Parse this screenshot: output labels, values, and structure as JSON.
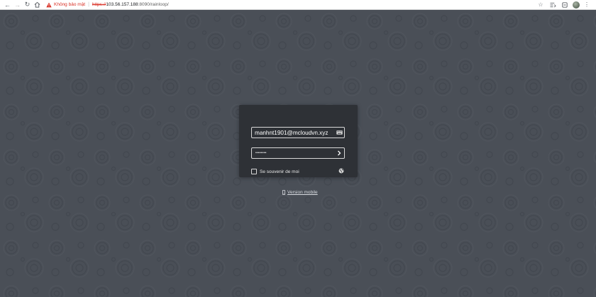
{
  "browser": {
    "security_label": "Không bảo mật",
    "url_scheme": "https://",
    "url_host": "103.56.157.188",
    "url_rest": ":8090/rainloop/",
    "warning_color": "#d93025"
  },
  "login": {
    "email_value": "manhnt1901@mcloudvn.xyz",
    "password_masked": "••••••••",
    "remember_label": "Se souvenir de moi",
    "submit_icon": "chevron-right-icon",
    "email_icon": "keyboard-icon",
    "language_icon": "globe-icon"
  },
  "footer": {
    "mobile_link_label": "Version mobile",
    "mobile_icon": "mobile-phone-icon"
  },
  "colors": {
    "background": "#4a4f57",
    "panel": "#2e3136",
    "field_border": "#d8d8d8"
  }
}
